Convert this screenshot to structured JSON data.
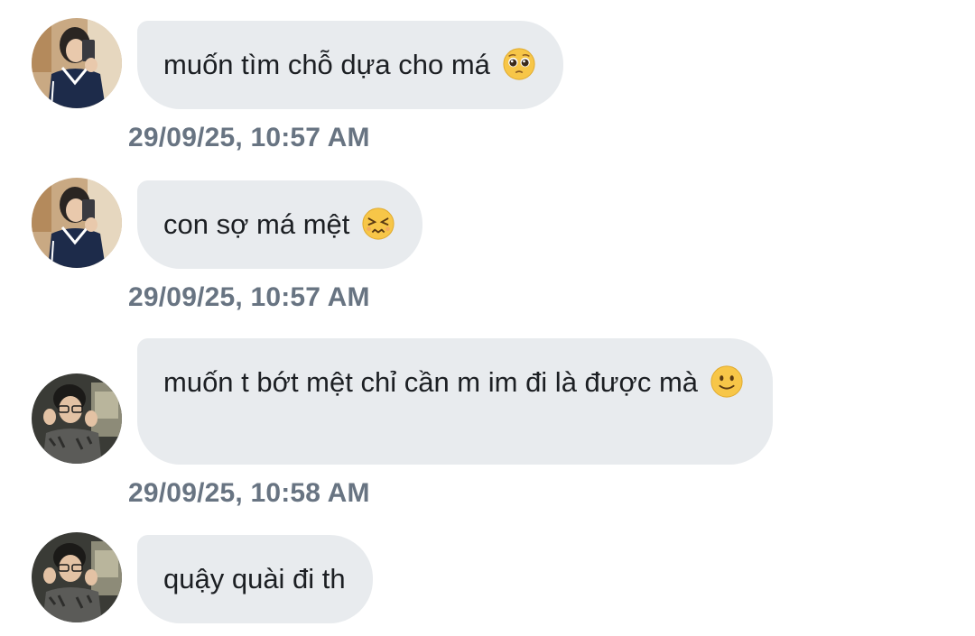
{
  "messages": [
    {
      "sender": "avatar-a",
      "text": "muốn tìm chỗ dựa cho má",
      "emoji": "pleading-face-icon",
      "timestamp": "29/09/25, 10:57 AM"
    },
    {
      "sender": "avatar-a",
      "text": "con sợ má mệt",
      "emoji": "persevering-face-icon",
      "timestamp": "29/09/25, 10:57 AM"
    },
    {
      "sender": "avatar-b",
      "text": "muốn t bớt mệt chỉ cần m im đi là được mà",
      "emoji": "slightly-smiling-face-icon",
      "timestamp": "29/09/25, 10:58 AM"
    },
    {
      "sender": "avatar-b",
      "text": "quậy quài đi th"
    }
  ],
  "colors": {
    "bubble": "#e8ebee",
    "text": "#1c1f23",
    "timestamp": "#687482",
    "background": "#ffffff"
  }
}
